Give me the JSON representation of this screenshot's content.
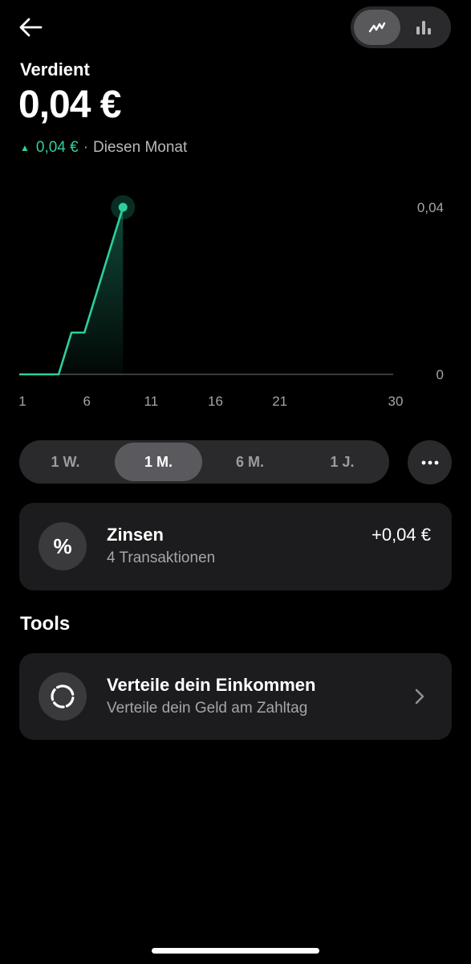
{
  "header": {
    "back_icon": "arrow-left-icon",
    "view_toggle": {
      "line_icon": "line-chart-icon",
      "bar_icon": "bar-chart-icon",
      "selected": "line"
    }
  },
  "summary": {
    "label": "Verdient",
    "amount": "0,04 €",
    "change_amount": "0,04 €",
    "separator": "·",
    "period": "Diesen Monat"
  },
  "chart_data": {
    "type": "area",
    "x": [
      1,
      2,
      3,
      4,
      5,
      6,
      7,
      8,
      9
    ],
    "values": [
      0,
      0,
      0,
      0,
      0.01,
      0.01,
      0.02,
      0.03,
      0.04
    ],
    "x_ticks": [
      "1",
      "6",
      "11",
      "16",
      "21",
      "30"
    ],
    "y_ticks": [
      "0,04",
      "0"
    ],
    "xlim": [
      1,
      30
    ],
    "ylim": [
      0,
      0.04
    ],
    "color": "#2ecf9f",
    "grid": false
  },
  "range_selector": {
    "options": [
      "1 W.",
      "1 M.",
      "6 M.",
      "1 J."
    ],
    "selected": "1 M.",
    "more_icon": "more-horizontal-icon"
  },
  "interest_card": {
    "icon": "percent-icon",
    "icon_glyph": "%",
    "title": "Zinsen",
    "subtitle": "4 Transaktionen",
    "amount": "+0,04 €"
  },
  "tools": {
    "heading": "Tools",
    "items": [
      {
        "icon": "circle-split-icon",
        "title": "Verteile dein Einkommen",
        "subtitle": "Verteile dein Geld am Zahltag",
        "chevron": "chevron-right-icon"
      }
    ]
  },
  "colors": {
    "accent": "#2ecf9f",
    "background": "#000000",
    "card": "#1c1c1e"
  }
}
